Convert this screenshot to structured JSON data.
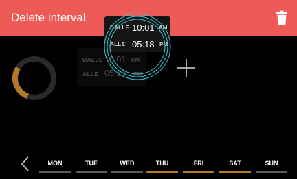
{
  "header": {
    "title": "Delete interval",
    "bg_color": "#ee5a55"
  },
  "intervals": [
    {
      "from_label": "DALLE",
      "from_time": "10:01",
      "from_ampm": "AM",
      "to_label": "ALLE",
      "to_time": "05:18",
      "to_ampm": "PM"
    }
  ],
  "dragged_interval": {
    "from_label": "DALLE",
    "from_time": "10:01",
    "from_ampm": "AM",
    "to_label": "ALLE",
    "to_time": "05:18",
    "to_ampm": "PM"
  },
  "schedule_ring": {
    "track_color": "#2a2a2a",
    "active_color": "#b0782a"
  },
  "weekdays": {
    "days": [
      {
        "label": "MON",
        "active": false
      },
      {
        "label": "TUE",
        "active": false
      },
      {
        "label": "WED",
        "active": false
      },
      {
        "label": "THU",
        "active": true
      },
      {
        "label": "FRI",
        "active": true
      },
      {
        "label": "SAT",
        "active": true
      },
      {
        "label": "SUN",
        "active": false
      }
    ],
    "active_color": "#b0782a",
    "inactive_color": "#5a5a5a"
  }
}
